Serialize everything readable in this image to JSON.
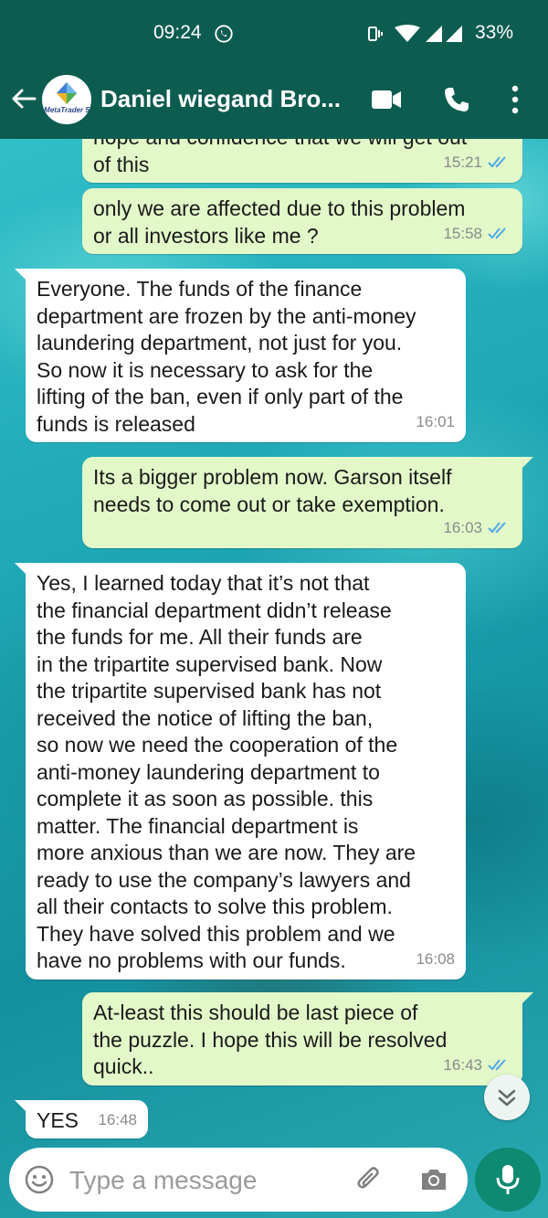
{
  "status_bar": {
    "time": "09:24",
    "battery": "33%"
  },
  "header": {
    "contact_name": "Daniel wiegand Bro...",
    "avatar_text": "MetaTrader 5"
  },
  "messages": [
    {
      "dir": "out",
      "text": "hope and confidence that we will get out\nof this",
      "time": "15:21",
      "ticks": "read"
    },
    {
      "dir": "out",
      "text": "only we are affected due to this problem\nor all investors like me ?",
      "time": "15:58",
      "ticks": "read"
    },
    {
      "dir": "in",
      "text": "Everyone. The funds of the finance\ndepartment are frozen by the anti-money\nlaundering department, not just for you.\nSo now it is necessary to ask for the\nlifting of the ban, even if only part of the\nfunds is released",
      "time": "16:01"
    },
    {
      "dir": "out",
      "text": "Its a bigger problem now. Garson itself\nneeds to come out or take exemption.",
      "time": "16:03",
      "ticks": "read"
    },
    {
      "dir": "in",
      "text": "Yes, I learned today that it’s not that\nthe financial department didn’t release\nthe funds for me. All their funds are\nin the tripartite supervised bank. Now\nthe tripartite supervised bank has not\nreceived the notice of lifting the ban,\nso now we need the cooperation of the\nanti-money laundering department to\ncomplete it as soon as possible. this\nmatter. The financial department is\nmore anxious than we are now. They are\nready to use the company’s lawyers and\nall their contacts to solve this problem.\nThey have solved this problem and we\nhave no problems with our funds.",
      "time": "16:08"
    },
    {
      "dir": "out",
      "text": "At-least this should be last piece of\nthe puzzle. I hope this will be resolved\nquick..",
      "time": "16:43",
      "ticks": "read"
    },
    {
      "dir": "in",
      "text": "YES",
      "time": "16:48"
    }
  ],
  "composer": {
    "placeholder": "Type a message"
  },
  "colors": {
    "header": "#0d5c50",
    "outgoing_bubble": "#e2f8c9",
    "incoming_bubble": "#ffffff",
    "read_ticks": "#4fa9e6",
    "mic_button": "#0f8a72"
  }
}
